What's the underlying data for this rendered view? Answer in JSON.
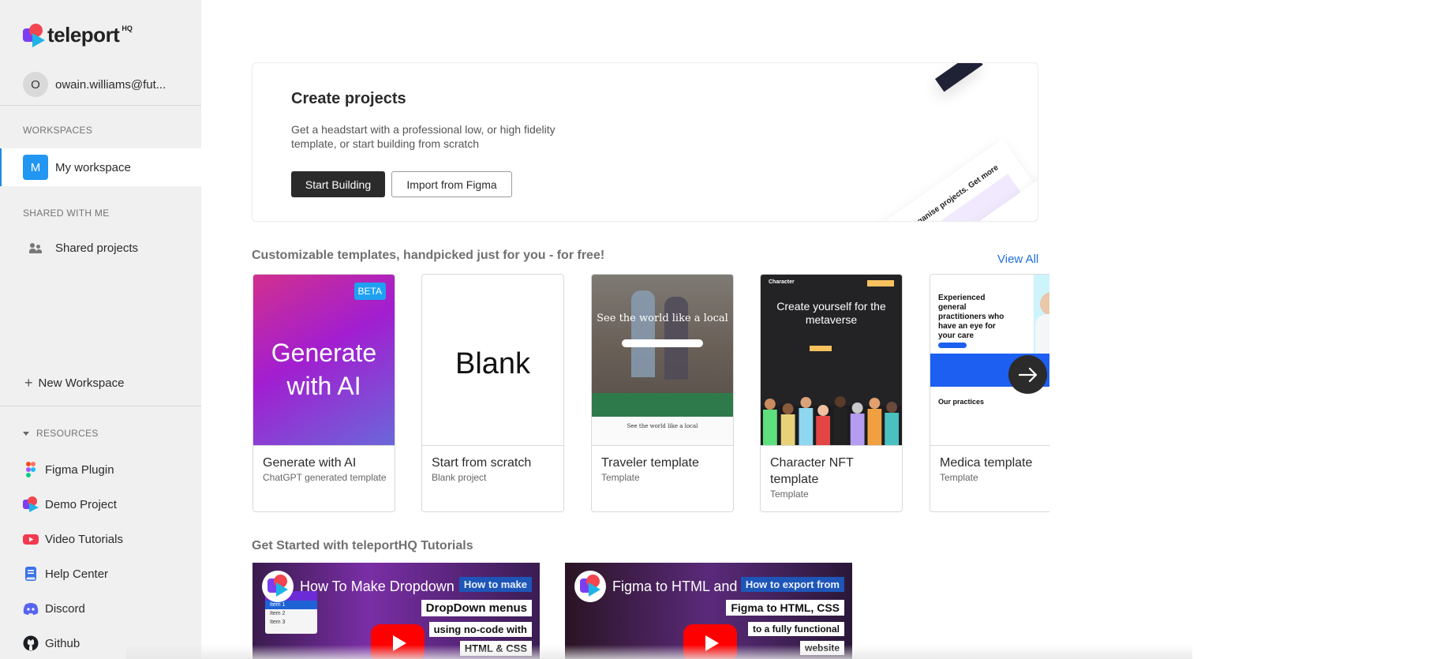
{
  "brand": {
    "name": "teleport",
    "suffix": "HQ"
  },
  "user": {
    "initial": "O",
    "email": "owain.williams@fut..."
  },
  "sidebar": {
    "workspaces_label": "WORKSPACES",
    "workspace": {
      "initial": "M",
      "label": "My workspace"
    },
    "shared_label": "SHARED WITH ME",
    "shared_item": "Shared projects",
    "new_workspace": "New Workspace",
    "resources_label": "RESOURCES",
    "resources": [
      {
        "label": "Figma Plugin",
        "icon": "figma-icon"
      },
      {
        "label": "Demo Project",
        "icon": "teleport-logo-icon"
      },
      {
        "label": "Video Tutorials",
        "icon": "youtube-icon"
      },
      {
        "label": "Help Center",
        "icon": "book-icon"
      },
      {
        "label": "Discord",
        "icon": "discord-icon"
      },
      {
        "label": "Github",
        "icon": "github-icon"
      }
    ]
  },
  "create": {
    "title": "Create projects",
    "description": "Get a headstart with a professional low, or high fidelity template, or start building from scratch",
    "start_button": "Start Building",
    "import_button": "Import from Figma",
    "hero_text": "Organise projects. Get more done."
  },
  "templates": {
    "heading": "Customizable templates, handpicked just for you - for free!",
    "view_all": "View All",
    "items": [
      {
        "name": "Generate with AI",
        "subtitle": "ChatGPT generated template",
        "thumb_text": "Generate with AI",
        "badge": "BETA"
      },
      {
        "name": "Start from scratch",
        "subtitle": "Blank project",
        "thumb_text": "Blank"
      },
      {
        "name": "Traveler template",
        "subtitle": "Template",
        "thumb_text": "See the world like a local",
        "thumb_subtext": "See the world like a local"
      },
      {
        "name": "Character NFT template",
        "subtitle": "Template",
        "thumb_text": "Create yourself for the metaverse",
        "thumb_brand": "Character"
      },
      {
        "name": "Medica template",
        "subtitle": "Template",
        "thumb_text": "Experienced general practitioners who have an eye for your care",
        "thumb_subtext": "Our practices"
      }
    ]
  },
  "tutorials": {
    "heading": "Get Started with teleportHQ Tutorials",
    "videos": [
      {
        "title": "How To Make Dropdown Me...",
        "captions": [
          "How to make",
          "DropDown menus",
          "using no-code with",
          "HTML & CSS"
        ],
        "menu_items": [
          "Item 1",
          "Item 2",
          "Item 3"
        ]
      },
      {
        "title": "Figma to HTML and CSS ex...",
        "captions": [
          "How to export from",
          "Figma to HTML, CSS",
          "to a fully functional",
          "website"
        ]
      }
    ]
  },
  "colors": {
    "accent": "#1e88e5",
    "workspace_badge": "#2196f3",
    "link": "#1e6fd9",
    "primary_button": "#2b2b2b",
    "sidebar_bg": "#f0f0f0"
  }
}
